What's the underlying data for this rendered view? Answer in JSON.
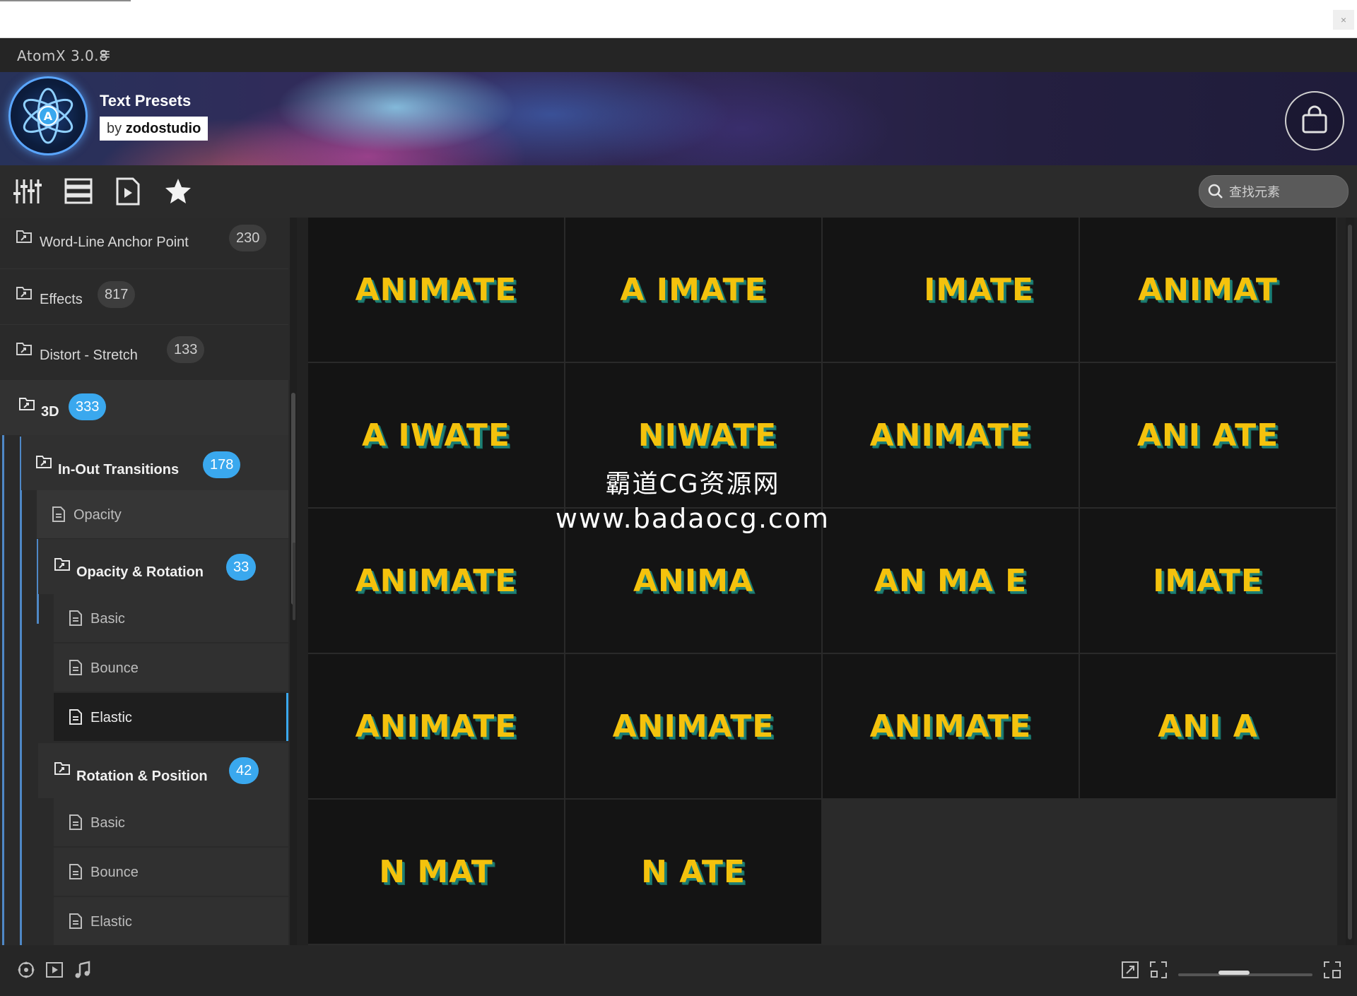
{
  "app": {
    "title": "AtomX 3.0.8",
    "menu_icon": "hamburger-icon"
  },
  "banner": {
    "title": "Text Presets",
    "by": "by",
    "author": "zodostudio",
    "logo": "atom-logo",
    "cart_icon": "shopping-bag-icon"
  },
  "toolbar": {
    "tools": [
      "sliders-icon",
      "list-view-icon",
      "video-file-icon",
      "star-icon"
    ],
    "search_placeholder": "查找元素"
  },
  "sidebar": {
    "items": [
      {
        "label": "Word-Line Anchor Point",
        "count": "230"
      },
      {
        "label": "Effects",
        "count": "817"
      },
      {
        "label": "Distort - Stretch",
        "count": "133"
      },
      {
        "label": "3D",
        "count": "333"
      },
      {
        "label": "In-Out Transitions",
        "count": "178"
      },
      {
        "label": "Opacity"
      },
      {
        "label": "Opacity & Rotation",
        "count": "33"
      },
      {
        "label": "Basic"
      },
      {
        "label": "Bounce"
      },
      {
        "label": "Elastic"
      },
      {
        "label": "Rotation & Position",
        "count": "42"
      },
      {
        "label": "Basic"
      },
      {
        "label": "Bounce"
      },
      {
        "label": "Elastic"
      }
    ]
  },
  "previews": [
    "ANIMATE",
    "A IMATE",
    "IMATE",
    "ANIMAT",
    "A  IWATE",
    "NIWATE",
    "ANIMATE",
    "ANI ATE",
    "ANIMATE",
    "ANIMA",
    "AN MA E",
    "IMATE",
    "ANIMATE",
    "ANIMATE",
    "ANIMATE",
    "ANI  A",
    "N MAT",
    "N ATE"
  ],
  "watermark": {
    "line1": "霸道CG资源网",
    "line2": "www.badaocg.com"
  },
  "colors": {
    "accent": "#3aa8ee",
    "preview_text": "#f4c20d",
    "preview_shadow": "#1d7f74"
  }
}
